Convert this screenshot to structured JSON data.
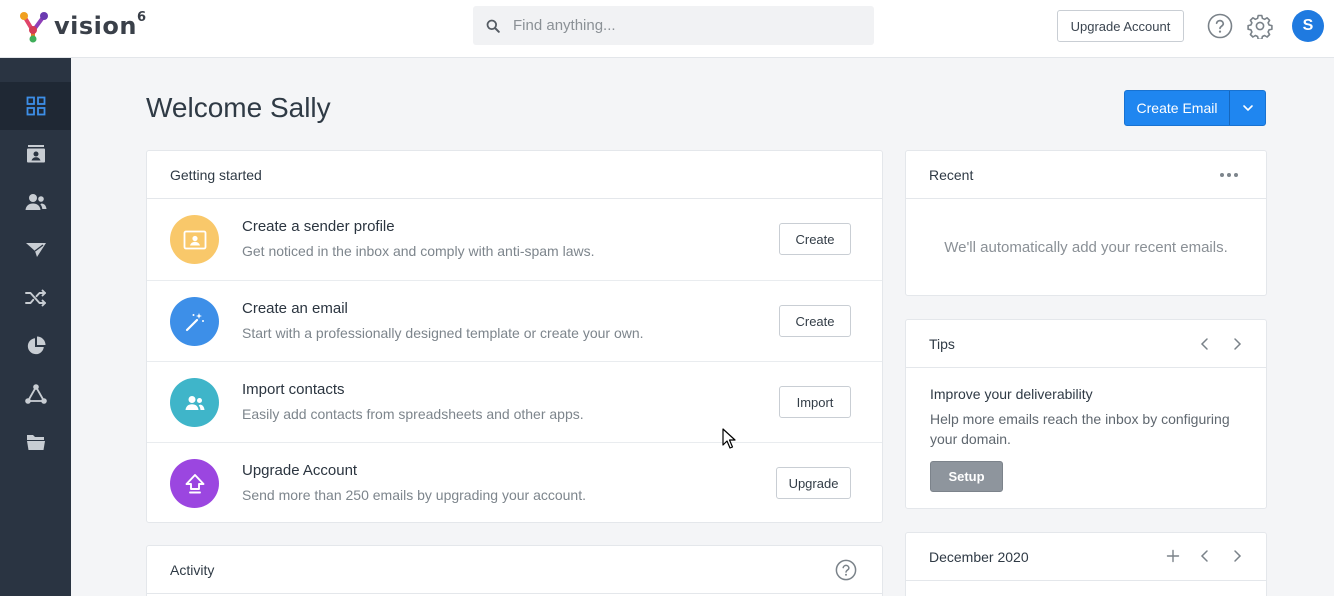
{
  "app": {
    "logo_text": "vision",
    "logo_sup": "6"
  },
  "header": {
    "search_placeholder": "Find anything...",
    "upgrade_label": "Upgrade Account",
    "avatar_initial": "S"
  },
  "sidebar": {
    "items": [
      {
        "icon": "dashboard-grid-icon",
        "active": true
      },
      {
        "icon": "contact-card-icon",
        "active": false
      },
      {
        "icon": "users-icon",
        "active": false
      },
      {
        "icon": "paper-plane-icon",
        "active": false
      },
      {
        "icon": "shuffle-icon",
        "active": false
      },
      {
        "icon": "pie-chart-icon",
        "active": false
      },
      {
        "icon": "network-icon",
        "active": false
      },
      {
        "icon": "folder-icon",
        "active": false
      }
    ]
  },
  "main": {
    "title": "Welcome Sally",
    "create_email_label": "Create Email"
  },
  "getting_started": {
    "title": "Getting started",
    "rows": [
      {
        "title": "Create a sender profile",
        "desc": "Get noticed in the inbox and comply with anti-spam laws.",
        "button": "Create",
        "icon": "id-card-icon",
        "color": "#f9c86a"
      },
      {
        "title": "Create an email",
        "desc": "Start with a professionally designed template or create your own.",
        "button": "Create",
        "icon": "magic-wand-icon",
        "color": "#3d8fe8"
      },
      {
        "title": "Import contacts",
        "desc": "Easily add contacts from spreadsheets and other apps.",
        "button": "Import",
        "icon": "contacts-icon",
        "color": "#3fb5c9"
      },
      {
        "title": "Upgrade Account",
        "desc": "Send more than 250 emails by upgrading your account.",
        "button": "Upgrade",
        "icon": "upload-arrow-icon",
        "color": "#9b46e0"
      }
    ]
  },
  "activity": {
    "title": "Activity"
  },
  "recent": {
    "title": "Recent",
    "empty_text": "We'll automatically add your recent emails."
  },
  "tips": {
    "title": "Tips",
    "tip_title": "Improve your deliverability",
    "tip_body": "Help more emails reach the inbox by configuring your domain.",
    "setup_label": "Setup"
  },
  "calendar": {
    "title": "December 2020"
  }
}
